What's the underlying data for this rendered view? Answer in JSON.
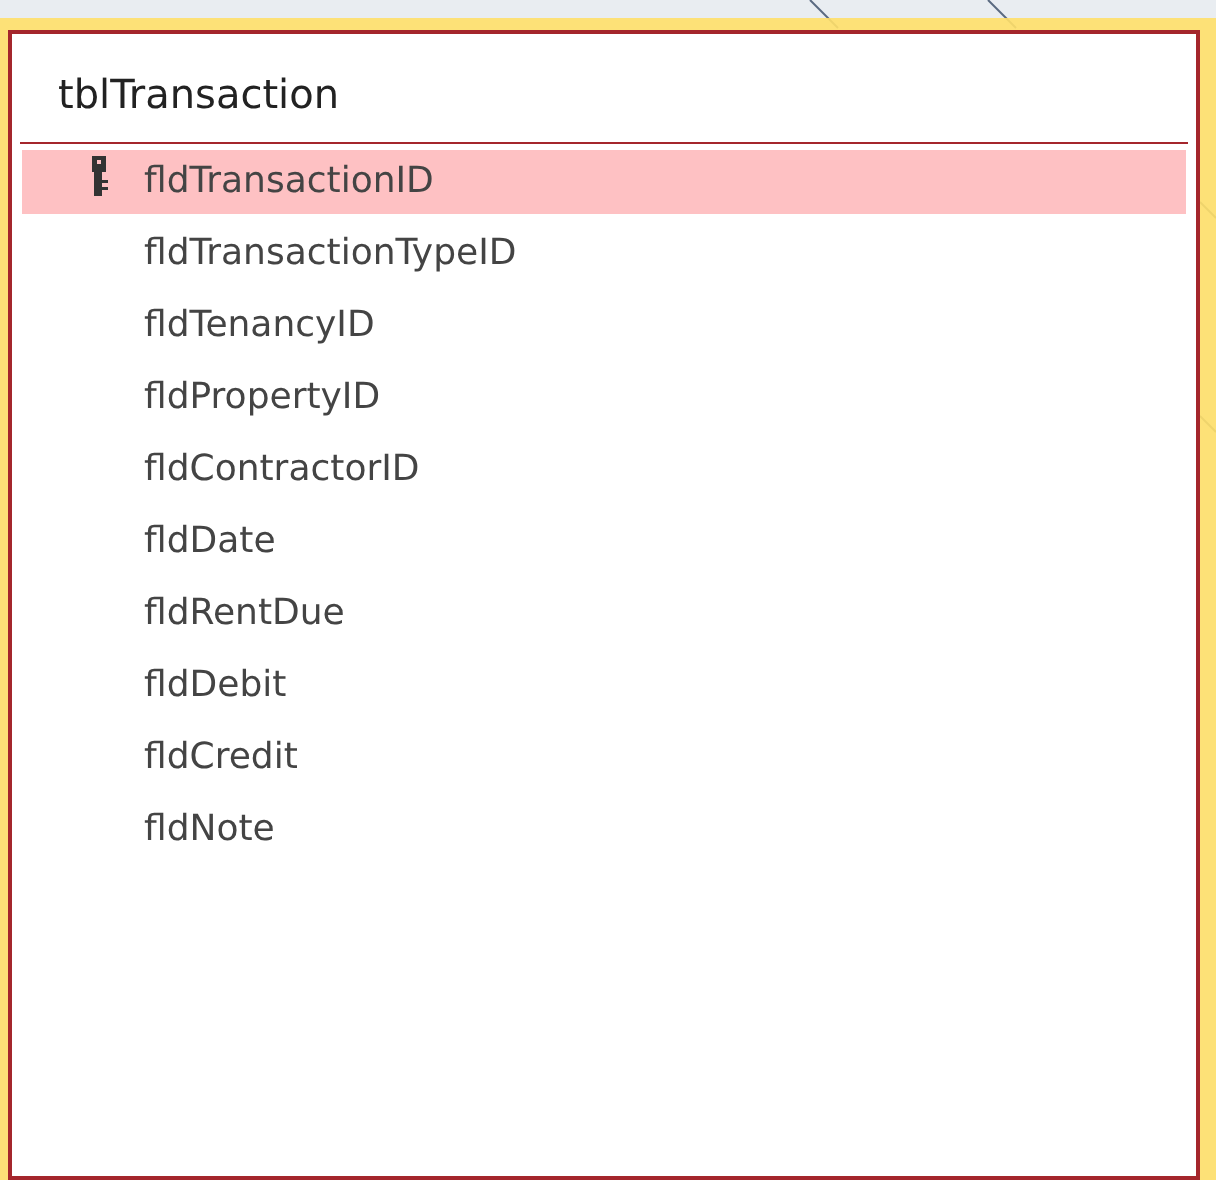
{
  "table": {
    "title": "tblTransaction",
    "fields": [
      {
        "name": "fldTransactionID",
        "primary_key": true,
        "selected": true
      },
      {
        "name": "fldTransactionTypeID",
        "primary_key": false,
        "selected": false
      },
      {
        "name": "fldTenancyID",
        "primary_key": false,
        "selected": false
      },
      {
        "name": "fldPropertyID",
        "primary_key": false,
        "selected": false
      },
      {
        "name": "fldContractorID",
        "primary_key": false,
        "selected": false
      },
      {
        "name": "fldDate",
        "primary_key": false,
        "selected": false
      },
      {
        "name": "fldRentDue",
        "primary_key": false,
        "selected": false
      },
      {
        "name": "fldDebit",
        "primary_key": false,
        "selected": false
      },
      {
        "name": "fldCredit",
        "primary_key": false,
        "selected": false
      },
      {
        "name": "fldNote",
        "primary_key": false,
        "selected": false
      }
    ]
  }
}
